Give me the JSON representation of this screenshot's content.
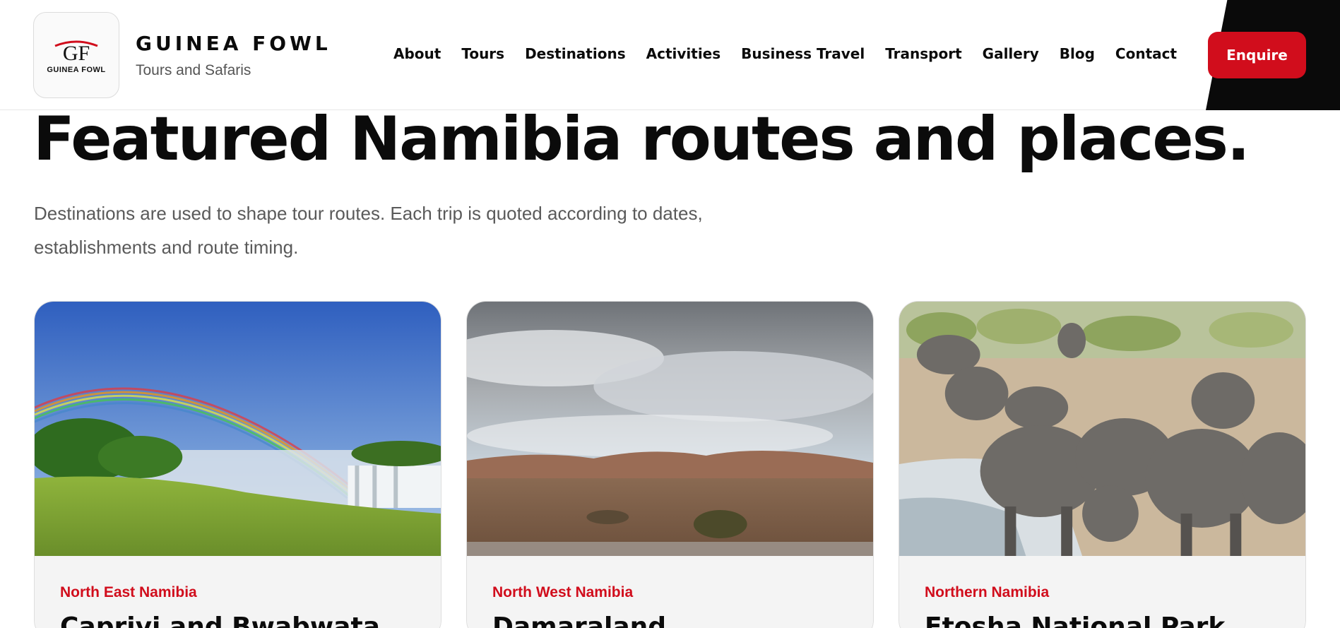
{
  "brand": {
    "logo_mark": "GF",
    "logo_caption": "GUINEA FOWL",
    "name": "GUINEA FOWL",
    "tagline": "Tours and Safaris",
    "accent_color": "#d10d1c"
  },
  "nav": {
    "items": [
      {
        "label": "About"
      },
      {
        "label": "Tours"
      },
      {
        "label": "Destinations"
      },
      {
        "label": "Activities"
      },
      {
        "label": "Business Travel"
      },
      {
        "label": "Transport"
      },
      {
        "label": "Gallery"
      },
      {
        "label": "Blog"
      },
      {
        "label": "Contact"
      }
    ],
    "cta_label": "Enquire"
  },
  "main": {
    "title": "Featured Namibia routes and places.",
    "lead": "Destinations are used to shape tour routes. Each trip is quoted according to dates, establishments and route timing."
  },
  "cards": [
    {
      "region": "North East Namibia",
      "name": "Caprivi and Bwabwata",
      "image": "waterfall-rainbow-photo"
    },
    {
      "region": "North West Namibia",
      "name": "Damaraland",
      "image": "desert-landscape-photo"
    },
    {
      "region": "Northern Namibia",
      "name": "Etosha National Park",
      "image": "elephants-waterhole-photo"
    }
  ]
}
